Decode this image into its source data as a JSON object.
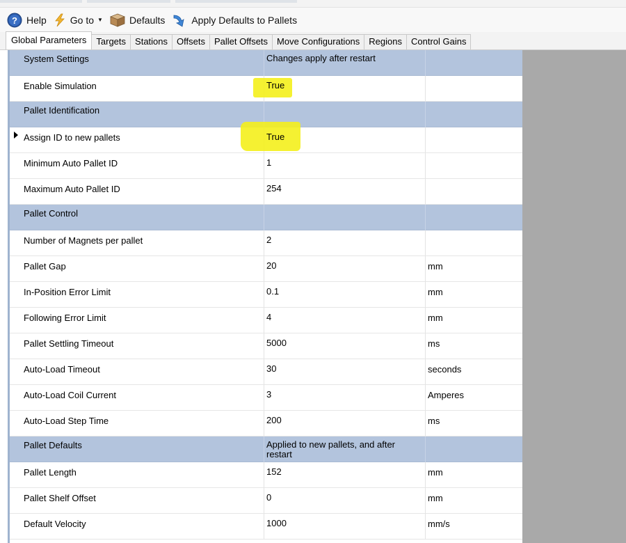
{
  "toolbar": {
    "help_label": "Help",
    "goto_label": "Go to",
    "defaults_label": "Defaults",
    "apply_label": "Apply Defaults to Pallets"
  },
  "tabs": [
    {
      "label": "Global Parameters"
    },
    {
      "label": "Targets"
    },
    {
      "label": "Stations"
    },
    {
      "label": "Offsets"
    },
    {
      "label": "Pallet Offsets"
    },
    {
      "label": "Move Configurations"
    },
    {
      "label": "Regions"
    },
    {
      "label": "Control Gains"
    }
  ],
  "rows": [
    {
      "name": "System Settings",
      "value": "Changes apply after restart",
      "unit": ""
    },
    {
      "name": "Enable Simulation",
      "value": "True",
      "unit": ""
    },
    {
      "name": "Pallet Identification",
      "value": "",
      "unit": ""
    },
    {
      "name": "Assign ID to new pallets",
      "value": "True",
      "unit": ""
    },
    {
      "name": "Minimum Auto Pallet ID",
      "value": "1",
      "unit": ""
    },
    {
      "name": "Maximum Auto Pallet ID",
      "value": "254",
      "unit": ""
    },
    {
      "name": "Pallet Control",
      "value": "",
      "unit": ""
    },
    {
      "name": "Number of Magnets per pallet",
      "value": "2",
      "unit": ""
    },
    {
      "name": "Pallet Gap",
      "value": "20",
      "unit": "mm"
    },
    {
      "name": "In-Position Error Limit",
      "value": "0.1",
      "unit": "mm"
    },
    {
      "name": "Following Error Limit",
      "value": "4",
      "unit": "mm"
    },
    {
      "name": "Pallet Settling Timeout",
      "value": "5000",
      "unit": "ms"
    },
    {
      "name": "Auto-Load Timeout",
      "value": "30",
      "unit": "seconds"
    },
    {
      "name": "Auto-Load Coil Current",
      "value": "3",
      "unit": "Amperes"
    },
    {
      "name": "Auto-Load Step Time",
      "value": "200",
      "unit": "ms"
    },
    {
      "name": "Pallet Defaults",
      "value": "Applied to new pallets, and after restart",
      "unit": ""
    },
    {
      "name": "Pallet Length",
      "value": "152",
      "unit": "mm"
    },
    {
      "name": "Pallet Shelf Offset",
      "value": "0",
      "unit": "mm"
    },
    {
      "name": "Default Velocity",
      "value": "1000",
      "unit": "mm/s"
    }
  ],
  "colors": {
    "section_row": "#b3c4dd",
    "highlight": "#f4f01c",
    "side_panel": "#a9a9a9"
  }
}
